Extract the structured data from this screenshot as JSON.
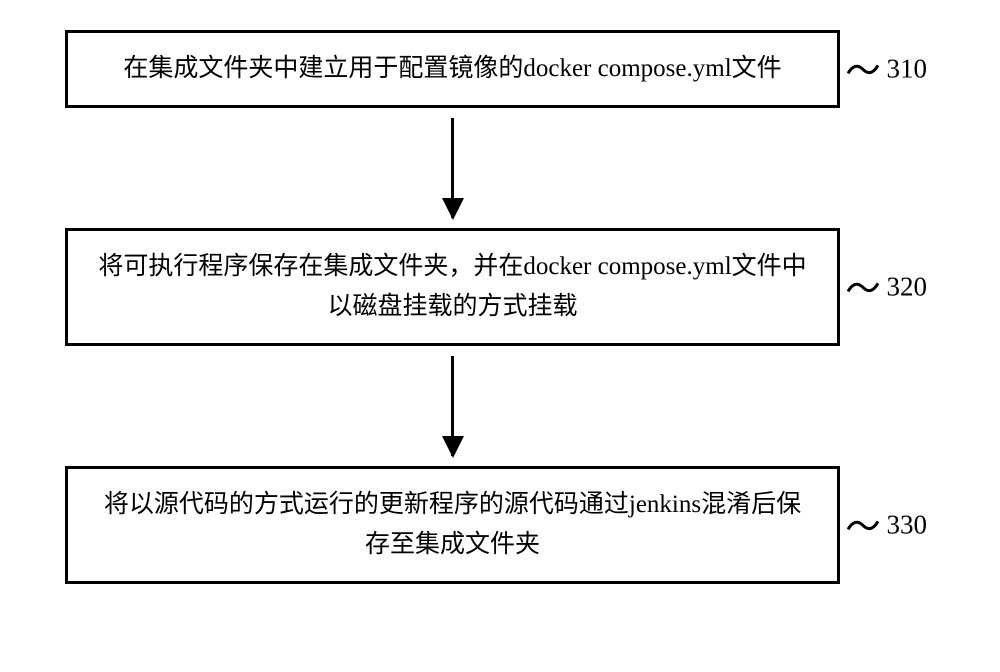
{
  "flowchart": {
    "steps": [
      {
        "text": "在集成文件夹中建立用于配置镜像的docker compose.yml文件",
        "label": "310"
      },
      {
        "text": "将可执行程序保存在集成文件夹，并在docker compose.yml文件中以磁盘挂载的方式挂载",
        "label": "320"
      },
      {
        "text": "将以源代码的方式运行的更新程序的源代码通过jenkins混淆后保存至集成文件夹",
        "label": "330"
      }
    ]
  }
}
